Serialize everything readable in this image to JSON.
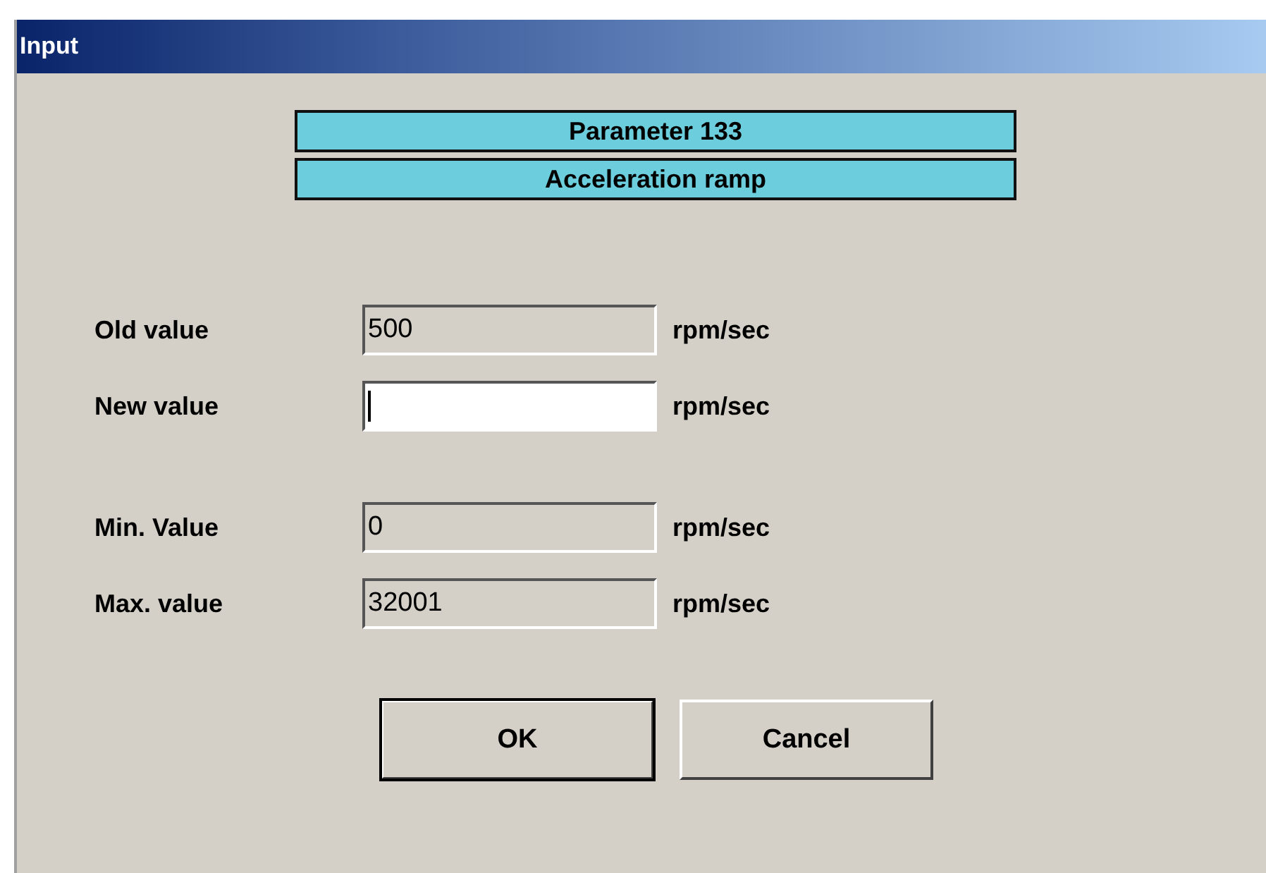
{
  "window": {
    "title": "Input"
  },
  "header": [
    "Parameter 133",
    "Acceleration ramp"
  ],
  "field_groups": [
    [
      {
        "label": "Old value",
        "value": "500",
        "unit": "rpm/sec",
        "kind": "readonly",
        "focused": false
      },
      {
        "label": "New value",
        "unit": "rpm/sec",
        "kind": "editable",
        "focused": true
      }
    ],
    [
      {
        "label": "Min. Value",
        "value": "0",
        "unit": "rpm/sec",
        "kind": "readonly",
        "focused": false
      },
      {
        "label": "Max. value",
        "value": "32001",
        "unit": "rpm/sec",
        "kind": "readonly",
        "focused": false
      }
    ]
  ],
  "buttons": [
    {
      "label": "OK",
      "default": true
    },
    {
      "label": "Cancel",
      "default": false
    }
  ]
}
